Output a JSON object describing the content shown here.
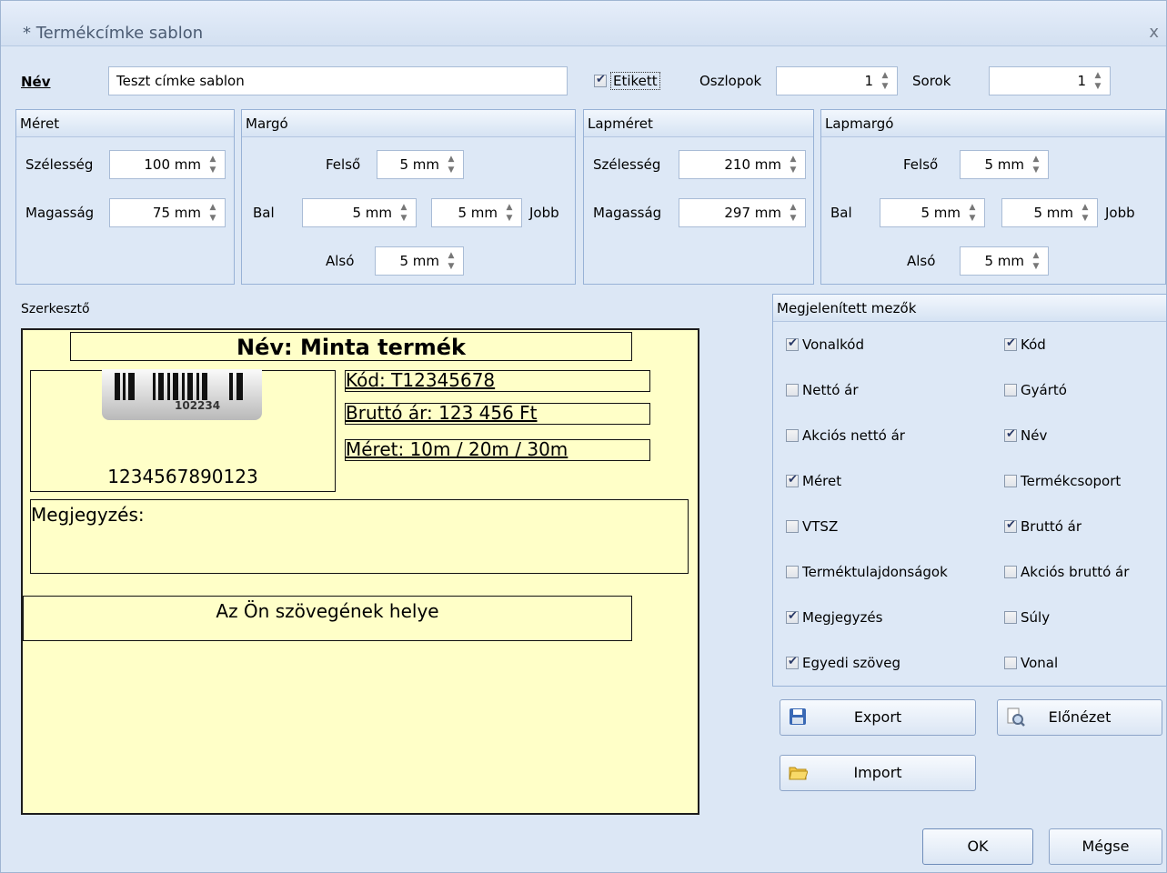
{
  "window": {
    "title": "* Termékcímke sablon",
    "close": "x"
  },
  "top": {
    "name_label": "Név",
    "name_value": "Teszt címke sablon",
    "etikett_label": "Etikett",
    "etikett_checked": true,
    "columns_label": "Oszlopok",
    "columns_value": "1",
    "rows_label": "Sorok",
    "rows_value": "1"
  },
  "meret": {
    "title": "Méret",
    "width_label": "Szélesség",
    "width_value": "100 mm",
    "height_label": "Magasság",
    "height_value": "75 mm"
  },
  "margo": {
    "title": "Margó",
    "top_label": "Felső",
    "top_value": "5 mm",
    "left_label": "Bal",
    "left_value": "5 mm",
    "right_value": "5 mm",
    "right_label": "Jobb",
    "bottom_label": "Alsó",
    "bottom_value": "5 mm"
  },
  "lapmeret": {
    "title": "Lapméret",
    "width_label": "Szélesség",
    "width_value": "210 mm",
    "height_label": "Magasság",
    "height_value": "297 mm"
  },
  "lapmargo": {
    "title": "Lapmargó",
    "top_label": "Felső",
    "top_value": "5 mm",
    "left_label": "Bal",
    "left_value": "5 mm",
    "right_value": "5 mm",
    "right_label": "Jobb",
    "bottom_label": "Alsó",
    "bottom_value": "5 mm"
  },
  "editor": {
    "label": "Szerkesztő",
    "name_line": "Név: Minta termék",
    "barcode_caption": "102234",
    "barcode_number": "1234567890123",
    "code_line": "Kód: T12345678",
    "price_line": "Bruttó ár: 123 456 Ft",
    "size_line": "Méret: 10m / 20m / 30m",
    "note_line": "Megjegyzés:",
    "custom_line": "Az Ön szövegének helye"
  },
  "fields": {
    "title": "Megjelenített mezők",
    "items": [
      {
        "label": "Vonalkód",
        "checked": true
      },
      {
        "label": "Kód",
        "checked": true
      },
      {
        "label": "Nettó ár",
        "checked": false
      },
      {
        "label": "Gyártó",
        "checked": false
      },
      {
        "label": "Akciós nettó ár",
        "checked": false
      },
      {
        "label": "Név",
        "checked": true
      },
      {
        "label": "Méret",
        "checked": true
      },
      {
        "label": "Termékcsoport",
        "checked": false
      },
      {
        "label": "VTSZ",
        "checked": false
      },
      {
        "label": "Bruttó ár",
        "checked": true
      },
      {
        "label": "Terméktulajdonságok",
        "checked": false
      },
      {
        "label": "Akciós bruttó ár",
        "checked": false
      },
      {
        "label": "Megjegyzés",
        "checked": true
      },
      {
        "label": "Súly",
        "checked": false
      },
      {
        "label": "Egyedi szöveg",
        "checked": true
      },
      {
        "label": "Vonal",
        "checked": false
      }
    ]
  },
  "buttons": {
    "export": "Export",
    "preview": "Előnézet",
    "import": "Import",
    "ok": "OK",
    "cancel": "Mégse"
  },
  "colors": {
    "editor_bg": "#ffffc8",
    "panel_bg": "#dce7f5"
  }
}
